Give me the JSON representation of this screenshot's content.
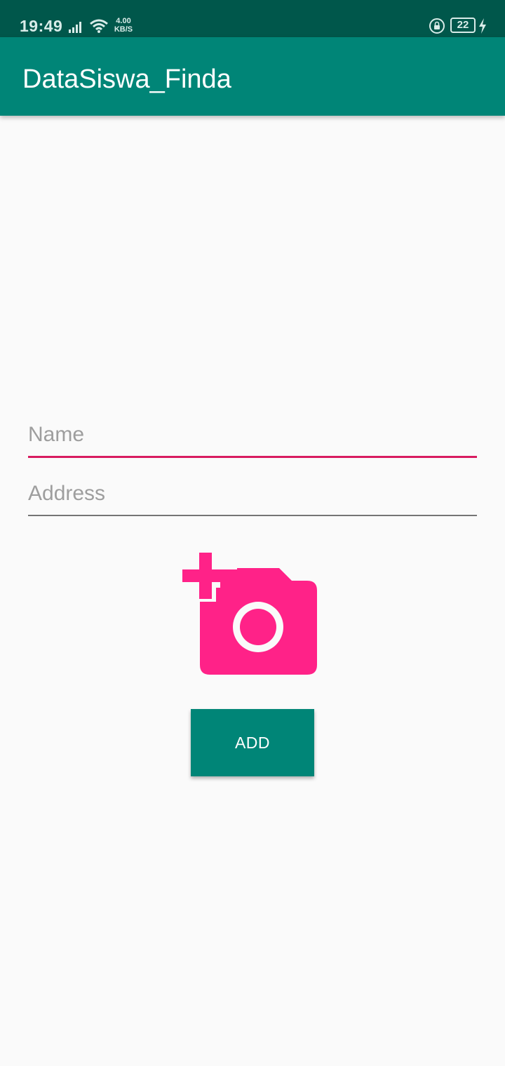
{
  "status_bar": {
    "time": "19:49",
    "net_speed_value": "4.00",
    "net_speed_unit": "KB/S",
    "battery_level": "22",
    "icons": [
      "signal-icon",
      "wifi-icon",
      "rotation-lock-icon",
      "battery-icon",
      "charging-icon"
    ]
  },
  "app_bar": {
    "title": "DataSiswa_Finda"
  },
  "form": {
    "name_placeholder": "Name",
    "name_value": "",
    "address_placeholder": "Address",
    "address_value": "",
    "add_button_label": "ADD",
    "image_picker_icon": "add-a-photo-icon"
  },
  "colors": {
    "status_bar": "#00574b",
    "primary": "#008577",
    "accent": "#ff2288",
    "focus_underline": "#d81b60",
    "background": "#fafafa"
  }
}
